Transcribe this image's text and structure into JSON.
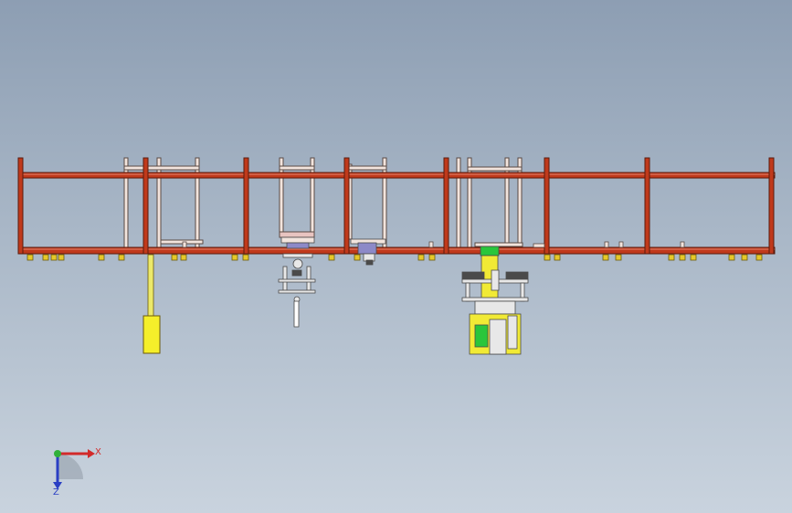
{
  "viewport": {
    "background_top": "#8d9eb3",
    "background_bottom": "#c9d3de"
  },
  "frame": {
    "beam_color": "#c0391b",
    "beam_highlight": "#e2836c",
    "beam_outline": "#5a1a0c",
    "pad_color": "#e6c829",
    "pad_outline": "#6b5a0c",
    "bracket_color": "#f2e4dd",
    "bracket_outline": "#5a4a44"
  },
  "stations": {
    "left_rod_color": "#ece96a",
    "left_cylinder_color": "#f5ef2a",
    "fixture_color": "#e8e8e8",
    "fixture_dark": "#4a4a4a",
    "accent_blue": "#8d89c8",
    "accent_green": "#29c63b",
    "accent_yellow": "#f1ea35"
  },
  "triad": {
    "x_label": "X",
    "z_label": "Z",
    "x_color": "#d22a2a",
    "z_color": "#2a3fc4",
    "y_color": "#2fb03a"
  }
}
